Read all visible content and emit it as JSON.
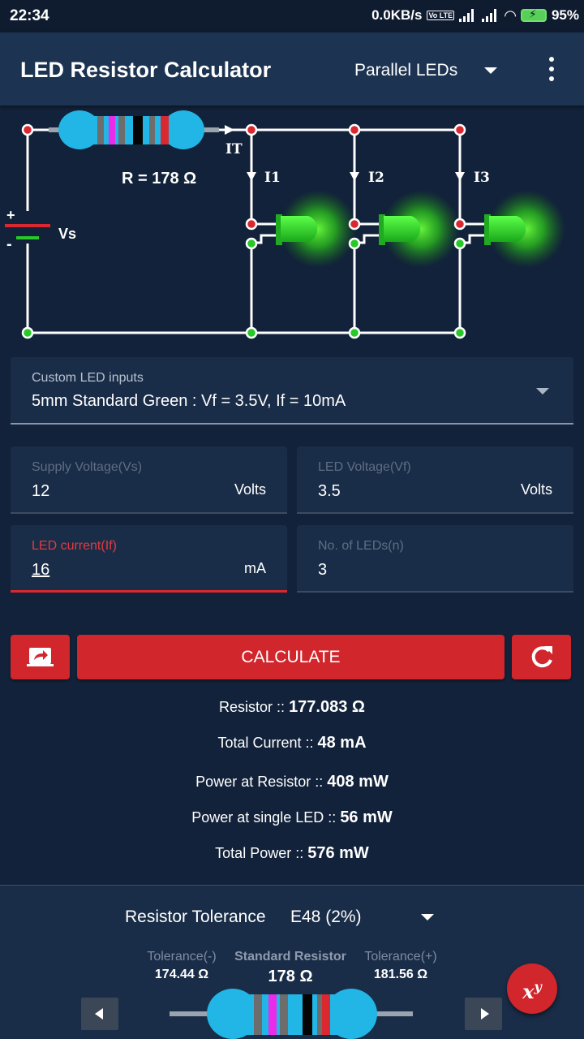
{
  "status": {
    "time": "22:34",
    "speed": "0.0KB/s",
    "volte": "Vo LTE",
    "battery": "95%"
  },
  "appbar": {
    "title": "LED Resistor Calculator",
    "mode": "Parallel LEDs"
  },
  "circuit": {
    "resistor_label": "R = 178 Ω",
    "total_current_label": "IT",
    "supply_label": "Vs",
    "plus": "+",
    "minus": "-",
    "branch_labels": [
      "I1",
      "I2",
      "I3"
    ],
    "led_color": "#22cc22",
    "wire_color": "#ffffff",
    "node_red": "#d9282f",
    "node_green": "#28c828"
  },
  "led_select": {
    "label": "Custom LED inputs",
    "value": "5mm Standard Green : Vf = 3.5V, If = 10mA"
  },
  "inputs": {
    "supply": {
      "label": "Supply Voltage(Vs)",
      "value": "12",
      "unit": "Volts"
    },
    "led_voltage": {
      "label": "LED Voltage(Vf)",
      "value": "3.5",
      "unit": "Volts"
    },
    "led_current": {
      "label": "LED current(If)",
      "value": "16",
      "unit": "mA"
    },
    "num_leds": {
      "label": "No. of LEDs(n)",
      "value": "3"
    }
  },
  "actions": {
    "calculate": "CALCULATE"
  },
  "results": [
    {
      "label": "Resistor :: ",
      "value": "177.083 Ω"
    },
    {
      "label": "Total Current :: ",
      "value": "48 mA"
    },
    {
      "label": "Power at Resistor :: ",
      "value": "408 mW"
    },
    {
      "label": "Power at single LED :: ",
      "value": "56 mW"
    },
    {
      "label": "Total Power :: ",
      "value": "576 mW"
    }
  ],
  "tolerance": {
    "title": "Resistor Tolerance",
    "series": "E48 (2%)",
    "minus_label": "Tolerance(-)",
    "minus_value": "174.44 Ω",
    "std_label": "Standard Resistor",
    "std_value": "178 Ω",
    "plus_label": "Tolerance(+)",
    "plus_value": "181.56 Ω"
  },
  "fab": {
    "base": "x",
    "exp": "y"
  },
  "colors": {
    "accent": "#d1262c",
    "background": "#12223a",
    "appbar": "#1c3352",
    "resistor_body": "#21b6e6"
  }
}
